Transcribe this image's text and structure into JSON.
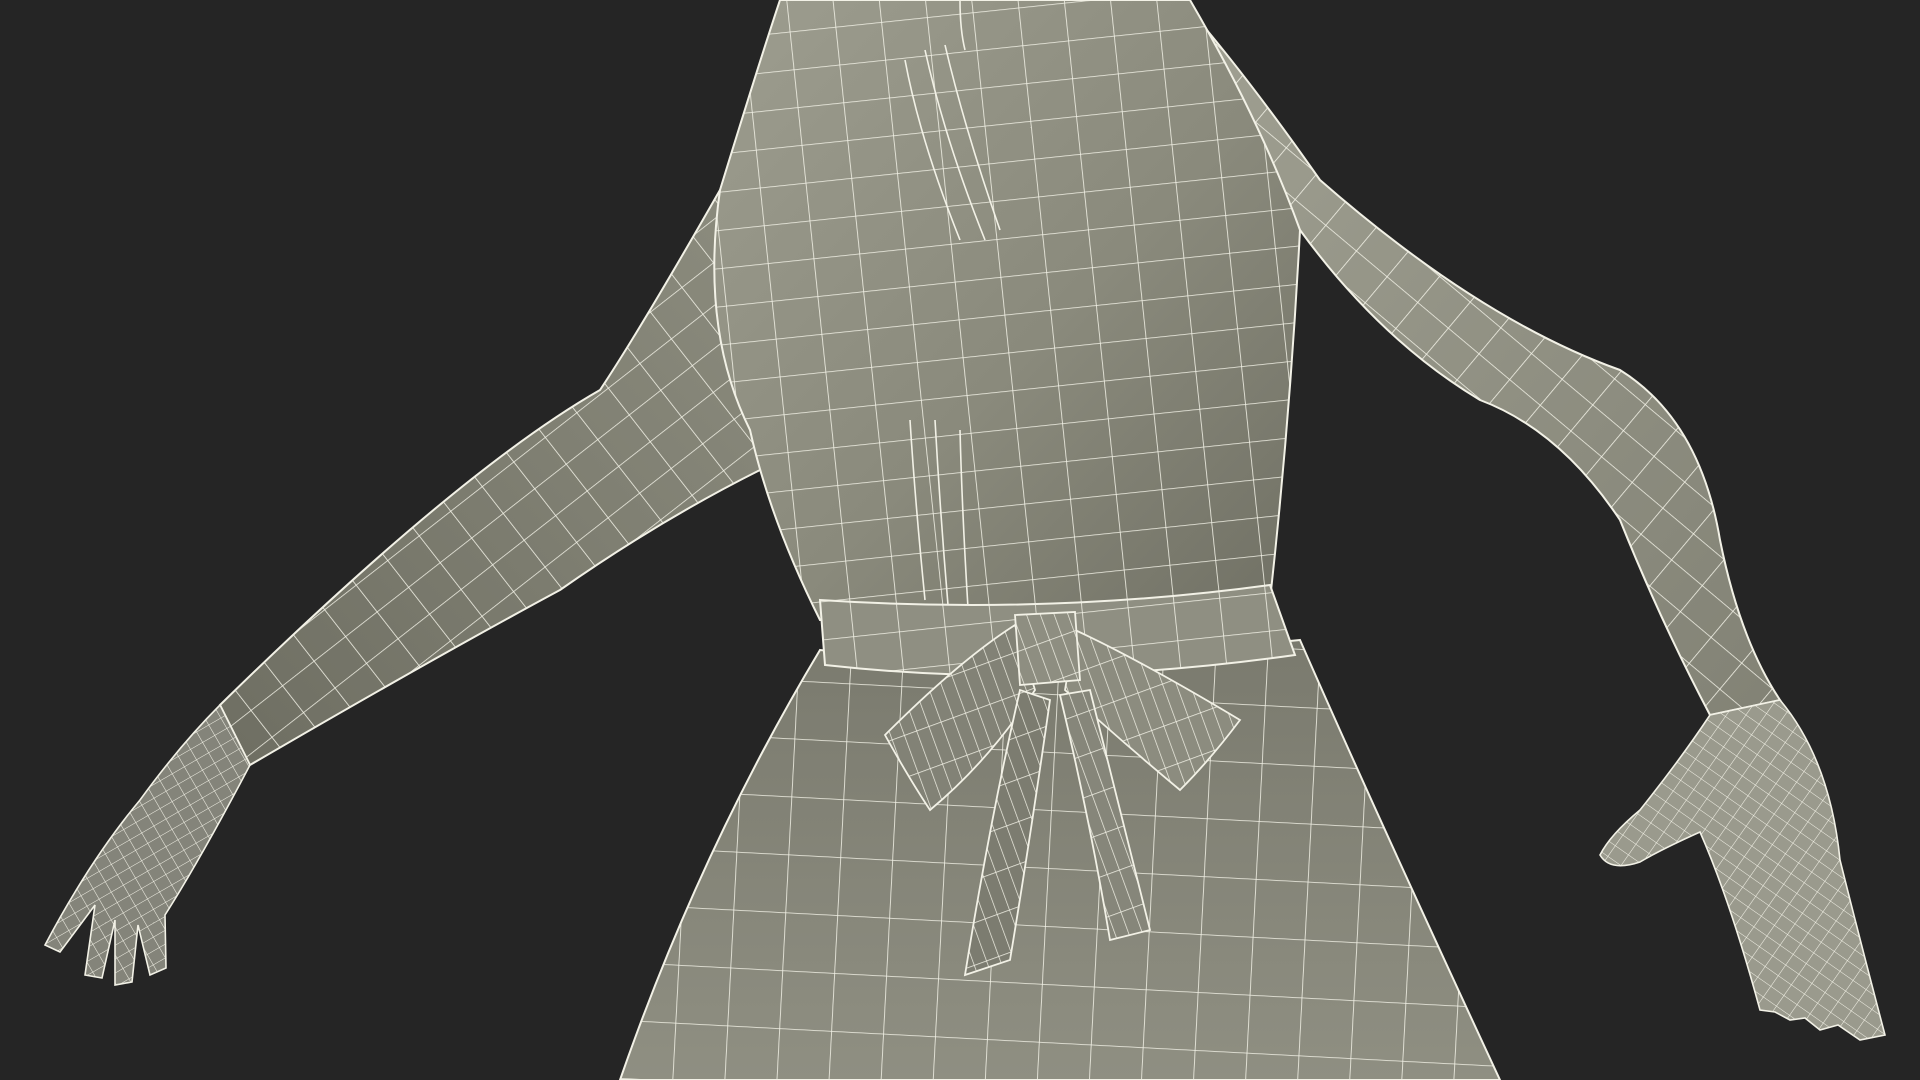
{
  "scene": {
    "subject": "wireframe-dress-figure",
    "colors": {
      "background": "#252525",
      "surface": "#8a8a7c",
      "surface_light": "#a3a395",
      "surface_dark": "#6c6c60",
      "wire": "#f2f1e6"
    }
  }
}
